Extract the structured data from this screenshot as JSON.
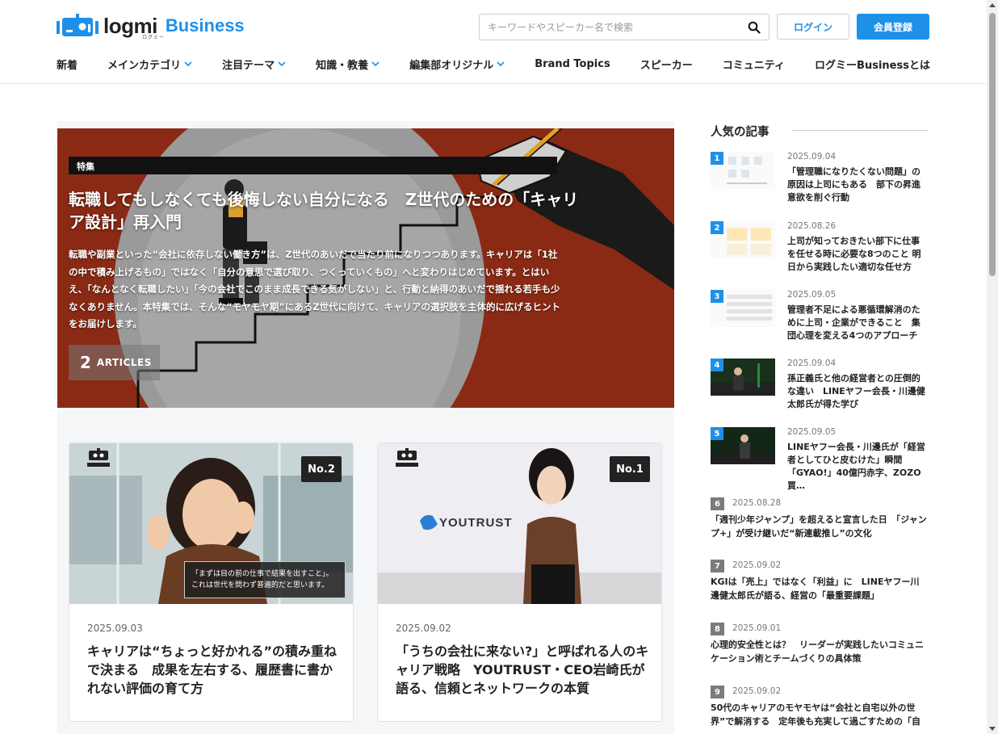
{
  "header": {
    "logo_text": "logmi",
    "logo_business": "Business",
    "logo_sub": "ログミー",
    "search_placeholder": "キーワードやスピーカー名で検索",
    "login_label": "ログイン",
    "register_label": "会員登録"
  },
  "nav": [
    {
      "label": "新着",
      "has_dropdown": false
    },
    {
      "label": "メインカテゴリ",
      "has_dropdown": true
    },
    {
      "label": "注目テーマ",
      "has_dropdown": true
    },
    {
      "label": "知識・教養",
      "has_dropdown": true
    },
    {
      "label": "編集部オリジナル",
      "has_dropdown": true
    },
    {
      "label": "Brand Topics",
      "has_dropdown": false
    },
    {
      "label": "スピーカー",
      "has_dropdown": false
    },
    {
      "label": "コミュニティ",
      "has_dropdown": false
    },
    {
      "label": "ログミーBusinessとは",
      "has_dropdown": false
    }
  ],
  "hero": {
    "tag": "特集",
    "title": "転職してもしなくても後悔しない自分になる　Z世代のための「キャリア設計」再入門",
    "description": "転職や副業といった“会社に依存しない働き方”は、Z世代のあいだで当たり前になりつつあります。キャリアは「1社の中で積み上げるもの」ではなく「自分の意思で選び取り、つくっていくもの」へと変わりはじめています。とはいえ、「なんとなく転職したい」「今の会社でこのまま成長できる気がしない」と、行動と納得のあいだで揺れる若手も少なくありません。本特集では、そんな“モヤモヤ期”にあるZ世代に向けて、キャリアの選択肢を主体的に広げるヒントをお届けします。",
    "articles_count": "2",
    "articles_label": "ARTICLES"
  },
  "cards": [
    {
      "rank": "No.2",
      "badge": "original",
      "date": "2025.09.03",
      "title": "キャリアは“ちょっと好かれる”の積み重ねで決まる　成果を左右する、履歴書に書かれない評価の育て方",
      "caption_line1": "「まずは目の前の仕事で結果を出すこと」。",
      "caption_line2": "これは世代を問わず普遍的だと思います。"
    },
    {
      "rank": "No.1",
      "badge": "original",
      "date": "2025.09.02",
      "title": "「うちの会社に来ない?」と呼ばれる人のキャリア戦略　YOUTRUST・CEO岩崎氏が語る、信頼とネットワークの本質",
      "brand_text": "YOUTRUST"
    }
  ],
  "sidebar": {
    "heading": "人気の記事",
    "ranked_with_image": [
      {
        "rank": "1",
        "date": "2025.09.04",
        "title": "「管理職になりたくない問題」の原因は上司にもある　部下の昇進意欲を削ぐ行動"
      },
      {
        "rank": "2",
        "date": "2025.08.26",
        "title": "上司が知っておきたい部下に仕事を任せる時に必要な8つのこと 明日から実践したい適切な任せ方"
      },
      {
        "rank": "3",
        "date": "2025.09.05",
        "title": "管理者不足による悪循環解消のために上司・企業ができること　集団心理を変える4つのアプローチ"
      },
      {
        "rank": "4",
        "date": "2025.09.04",
        "title": "孫正義氏と他の経営者との圧倒的な違い　LINEヤフー会長・川邊健太郎氏が得た学び"
      },
      {
        "rank": "5",
        "date": "2025.09.05",
        "title": "LINEヤフー会長・川邊氏が「経営者としてひと皮むけた」瞬間　「GYAO!」40億円赤字、ZOZO買…"
      }
    ],
    "ranked_text": [
      {
        "rank": "6",
        "date": "2025.08.28",
        "title": "「週刊少年ジャンプ」を超えると宣言した日　「ジャンプ+」が受け継いだ“新連載推し”の文化"
      },
      {
        "rank": "7",
        "date": "2025.09.02",
        "title": "KGIは「売上」ではなく「利益」に　LINEヤフー川邊健太郎氏が語る、経営の「最重要課題」"
      },
      {
        "rank": "8",
        "date": "2025.09.01",
        "title": "心理的安全性とは？　リーダーが実践したいコミュニケーション術とチームづくりの具体策"
      },
      {
        "rank": "9",
        "date": "2025.09.02",
        "title": "50代のキャリアのモヤモヤは“会社と自宅以外の世界”で解消する　定年後も充実して過ごすための「自"
      }
    ]
  },
  "colors": {
    "accent": "#1e90e8",
    "hero_bg": "#8a2a14",
    "rank_top_badge": "#1e90e8",
    "rank_other_badge": "#7c7c7c"
  }
}
